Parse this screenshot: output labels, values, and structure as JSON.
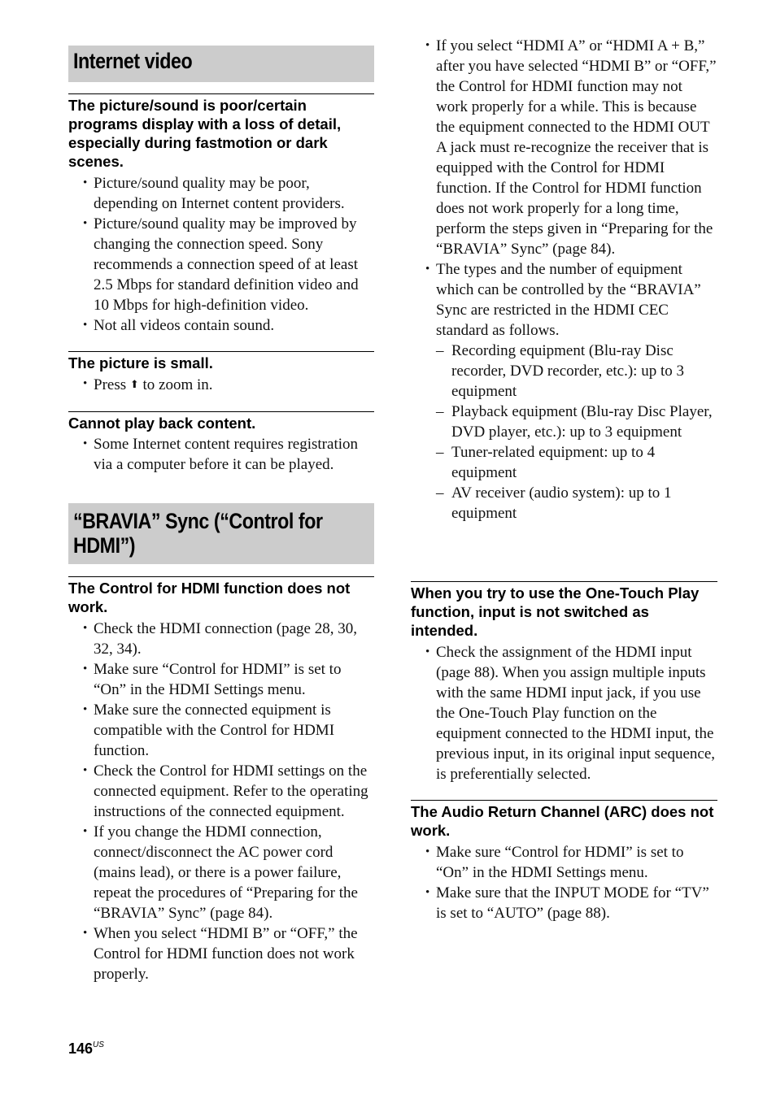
{
  "left_column": {
    "section1": {
      "title": "Internet video",
      "topics": [
        {
          "title": "The picture/sound is poor/certain programs display with a loss of detail, especially during fastmotion or dark scenes.",
          "bullets": [
            "Picture/sound quality may be poor, depending on Internet content providers.",
            "Picture/sound quality may be improved by changing the connection speed. Sony recommends a connection speed of at least 2.5 Mbps for standard definition video and 10 Mbps for high-definition video.",
            "Not all videos contain sound."
          ]
        },
        {
          "title": "The picture is small.",
          "bullet_prefix": "Press",
          "bullet_icon": "up-arrow-button",
          "bullet_suffix": "to zoom in."
        },
        {
          "title": "Cannot play back content.",
          "bullets": [
            "Some Internet content requires registration via a computer before it can be played."
          ]
        }
      ]
    },
    "section2": {
      "title": "“BRAVIA” Sync (“Control for HDMI”)",
      "topics": [
        {
          "title": "The Control for HDMI function does not work.",
          "bullets": [
            "Check the HDMI connection (page 28, 30, 32, 34).",
            "Make sure “Control for HDMI” is set to “On” in the HDMI Settings menu.",
            "Make sure the connected equipment is compatible with the Control for HDMI function.",
            "Check the Control for HDMI settings on the connected equipment. Refer to the operating instructions of the connected equipment.",
            "If you change the HDMI connection, connect/disconnect the AC power cord (mains lead), or there is a power failure, repeat the procedures of “Preparing for the “BRAVIA” Sync” (page 84).",
            "When you select “HDMI B” or “OFF,” the Control for HDMI function does not work properly."
          ]
        }
      ]
    }
  },
  "right_column": {
    "continued_bullets": [
      "If you select “HDMI A” or “HDMI A + B,” after you have selected “HDMI B” or “OFF,” the Control for HDMI function may not work properly for a while. This is because the equipment connected to the HDMI OUT A jack must re-recognize the receiver that is equipped with the Control for HDMI function. If the Control for HDMI function does not work properly for a long time, perform the steps given in “Preparing for the “BRAVIA” Sync” (page 84).",
      "The types and the number of equipment which can be controlled by the “BRAVIA” Sync are restricted in the HDMI CEC standard as follows."
    ],
    "sub_items": [
      "Recording equipment (Blu-ray Disc recorder, DVD recorder, etc.): up to 3 equipment",
      "Playback equipment (Blu-ray Disc Player, DVD player, etc.): up to 3 equipment",
      "Tuner-related equipment: up to 4 equipment",
      "AV receiver (audio system): up to 1 equipment"
    ],
    "topics": [
      {
        "title": "When you try to use the One-Touch Play function, input is not switched as intended.",
        "bullets": [
          "Check the assignment of the HDMI input (page 88). When you assign multiple inputs with the same HDMI input jack, if you use the One-Touch Play function on the equipment connected to the HDMI input, the previous input, in its original input sequence, is preferentially selected."
        ]
      },
      {
        "title": "The Audio Return Channel (ARC) does not work.",
        "bullets": [
          "Make sure “Control for HDMI” is set to “On” in the HDMI Settings menu.",
          "Make sure that the INPUT MODE for “TV” is set to “AUTO” (page 88)."
        ]
      }
    ]
  },
  "footer": {
    "page_number": "146",
    "region": "US"
  }
}
